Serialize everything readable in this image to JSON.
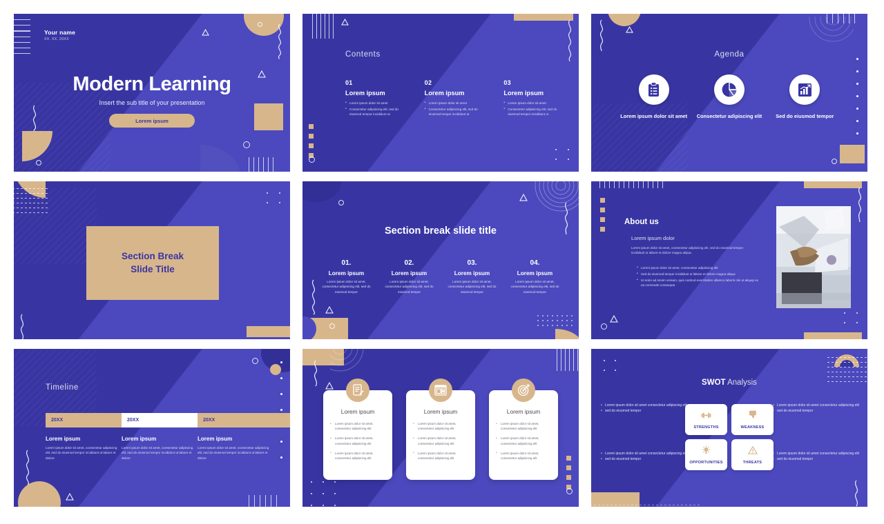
{
  "theme": {
    "blue_dark": "#3835a3",
    "blue_light": "#4b49bd",
    "tan": "#d8b68c",
    "white": "#ffffff"
  },
  "slides": [
    {
      "id": "title-slide",
      "author": "Your name",
      "date": "XX. XX. 20XX",
      "title": "Modern Learning",
      "subtitle": "Insert the sub title of your presentation",
      "button": "Lorem ipsum"
    },
    {
      "id": "contents-slide",
      "title": "Contents",
      "columns": [
        {
          "number": "01",
          "heading": "Lorem ipsum",
          "bullets": [
            "Lorem ipsum dolor sit amet",
            "Consectetur adipisicing elit, sed do eiusmod tempor incididunt ut"
          ]
        },
        {
          "number": "02",
          "heading": "Lorem ipsum",
          "bullets": [
            "Lorem ipsum dolor sit amet",
            "Consectetur adipisicing elit, sed do eiusmod tempor incididunt ut"
          ]
        },
        {
          "number": "03",
          "heading": "Lorem ipsum",
          "bullets": [
            "Lorem ipsum dolor sit amet",
            "Consectetur adipisicing elit, sed do eiusmod tempor incididunt ut"
          ]
        }
      ]
    },
    {
      "id": "agenda-slide",
      "title": "Agenda",
      "items": [
        {
          "icon": "clipboard-list-icon",
          "label": "Lorem ipsum dolor sit amet"
        },
        {
          "icon": "pie-chart-icon",
          "label": "Consectetur adipiscing elit"
        },
        {
          "icon": "bar-chart-growth-icon",
          "label": "Sed do eiusmod tempor"
        }
      ]
    },
    {
      "id": "section-break-box-slide",
      "title_line1": "Section Break",
      "title_line2": "Slide Title"
    },
    {
      "id": "section-break-four-slide",
      "title": "Section break slide title",
      "columns": [
        {
          "number": "01.",
          "heading": "Lorem ipsum",
          "text": "Lorem ipsum dolor sit amet, consectetur adipisicing elit, sed do eiusmod tempor"
        },
        {
          "number": "02.",
          "heading": "Lorem ipsum",
          "text": "Lorem ipsum dolor sit amet, consectetur adipisicing elit, sed do eiusmod tempor"
        },
        {
          "number": "03.",
          "heading": "Lorem ipsum",
          "text": "Lorem ipsum dolor sit amet, consectetur adipisicing elit, sed do eiusmod tempor"
        },
        {
          "number": "04.",
          "heading": "Lorem ipsum",
          "text": "Lorem ipsum dolor sit amet, consectetur adipisicing elit, sed do eiusmod tempor"
        }
      ]
    },
    {
      "id": "about-us-slide",
      "title": "About us",
      "subtitle": "Lorem ipsum dolor",
      "paragraph": "Lorem ipsum dolor sit amet, consectetur adipisicing elit, sed do eiusmod tempor incididunt ut labore et dolore magna aliqua.",
      "bullets": [
        "Lorem ipsum dolor sit amet, consectetur adipisicing elit",
        "Sed do eiusmod tempor incididunt ut labore et dolore magna aliqua",
        "Ut enim ad minim veniam, quis nostrud exercitation ullamco laboris nisi ut aliquip ex ea commodo consequat"
      ],
      "photo_alt": "hands typing on laptop at desk"
    },
    {
      "id": "timeline-slide",
      "title": "Timeline",
      "segments": [
        {
          "year": "20XX",
          "style": "tan"
        },
        {
          "year": "20XX",
          "style": "white"
        },
        {
          "year": "20XX",
          "style": "tan"
        }
      ],
      "columns": [
        {
          "heading": "Lorem ipsum",
          "text": "Lorem ipsum dolor sit amet, consectetur adipiscing elit, sed do eiusmod tempor incididunt ut labore et dolore"
        },
        {
          "heading": "Lorem ipsum",
          "text": "Lorem ipsum dolor sit amet, consectetur adipiscing elit, sed do eiusmod tempor incididunt ut labore et dolore"
        },
        {
          "heading": "Lorem ipsum",
          "text": "Lorem ipsum dolor sit amet, consectetur adipiscing elit, sed do eiusmod tempor incididunt ut labore et dolore"
        }
      ]
    },
    {
      "id": "three-cards-slide",
      "cards": [
        {
          "icon": "document-edit-icon",
          "heading": "Lorem ipsum",
          "bullets": [
            "Lorem ipsum dolor sit amet, consectetur adipisicing elit",
            "Lorem ipsum dolor sit amet, consectetur adipisicing elit",
            "Lorem ipsum dolor sit amet, consectetur adipisicing elit"
          ]
        },
        {
          "icon": "window-layout-icon",
          "heading": "Lorem ipsum",
          "bullets": [
            "Lorem ipsum dolor sit amet, consectetur adipisicing elit",
            "Lorem ipsum dolor sit amet, consectetur adipisicing elit",
            "Lorem ipsum dolor sit amet, consectetur adipisicing elit"
          ]
        },
        {
          "icon": "target-icon",
          "heading": "Lorem ipsum",
          "bullets": [
            "Lorem ipsum dolor sit amet, consectetur adipisicing elit",
            "Lorem ipsum dolor sit amet, consectetur adipisicing elit",
            "Lorem ipsum dolor sit amet, consectetur adipisicing elit"
          ]
        }
      ]
    },
    {
      "id": "swot-slide",
      "title_bold": "SWOT",
      "title_light": " Analysis",
      "cells": [
        {
          "icon": "dumbbell-icon",
          "label": "STRENGTHS"
        },
        {
          "icon": "thumbs-down-icon",
          "label": "WEAKNESS"
        },
        {
          "icon": "lightbulb-icon",
          "label": "OPPORTUNITIES"
        },
        {
          "icon": "warning-triangle-icon",
          "label": "THREATS"
        }
      ],
      "notes": [
        {
          "position": "top-left",
          "bullets": [
            "Lorem ipsum dolor sit amet consectetur adipiscing elit",
            "sed do eiusmod tempor"
          ]
        },
        {
          "position": "top-right",
          "bullets": [
            "Lorem ipsum dolor sit amet consectetur adipiscing elit",
            "sed do eiusmod tempor"
          ]
        },
        {
          "position": "bottom-left",
          "bullets": [
            "Lorem ipsum dolor sit amet consectetur adipiscing elit",
            "sed do eiusmod tempor"
          ]
        },
        {
          "position": "bottom-right",
          "bullets": [
            "Lorem ipsum dolor sit amet consectetur adipiscing elit",
            "sed do eiusmod tempor"
          ]
        }
      ]
    }
  ]
}
